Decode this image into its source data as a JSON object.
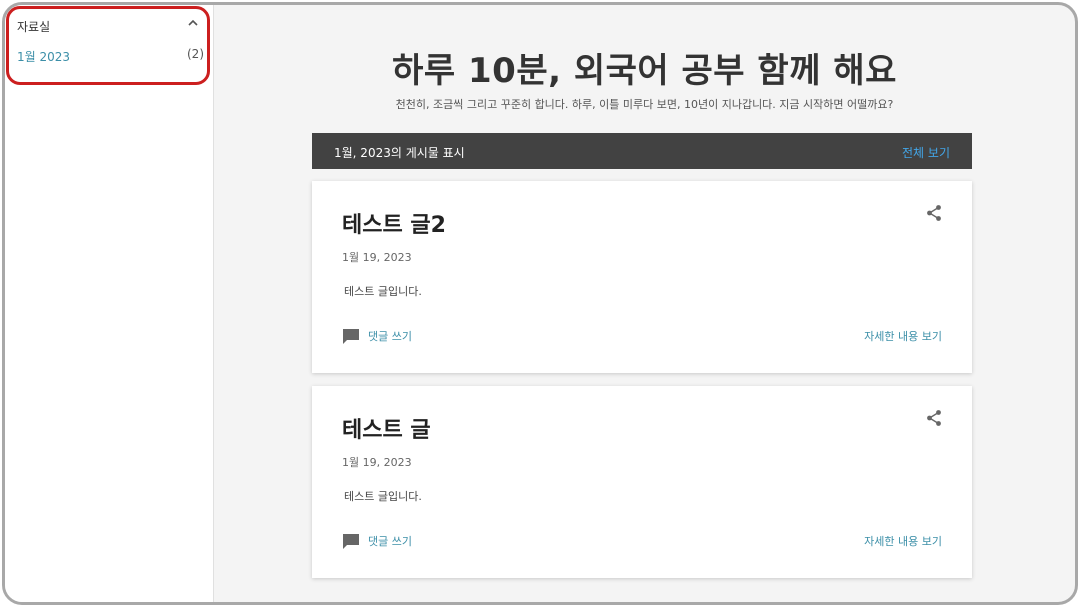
{
  "sidebar": {
    "archive_title": "자료실",
    "archive_item_label": "1월 2023",
    "archive_item_count": "(2)"
  },
  "header": {
    "title": "하루 10분, 외국어 공부 함께 해요",
    "description": "천천히, 조금씩 그리고 꾸준히 합니다. 하루, 이틀 미루다 보면, 10년이 지나갑니다. 지금 시작하면 어떨까요?"
  },
  "label_bar": {
    "text": "1월, 2023의 게시물 표시",
    "view_all": "전체 보기"
  },
  "posts": [
    {
      "title": "테스트 글2",
      "date": "1월 19, 2023",
      "body": "테스트 글입니다.",
      "comment_label": "댓글 쓰기",
      "more_label": "자세한 내용 보기"
    },
    {
      "title": "테스트 글",
      "date": "1월 19, 2023",
      "body": "테스트 글입니다.",
      "comment_label": "댓글 쓰기",
      "more_label": "자세한 내용 보기"
    }
  ],
  "icons": {
    "archive_toggle": "chevron-up-icon",
    "share": "share-icon",
    "comment": "comment-icon"
  },
  "colors": {
    "highlight_border": "#cc1f1f",
    "link": "#3c8fa8",
    "label_bar": "#424242",
    "view_all_link": "#43a6e8"
  }
}
